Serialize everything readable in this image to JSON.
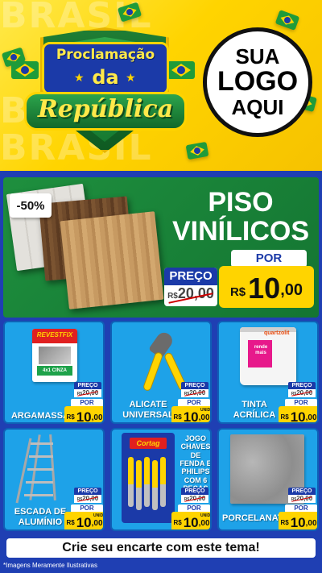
{
  "header": {
    "bg_words": [
      "BRASIL",
      "BRASIL",
      "BRASIL"
    ],
    "title_line1": "Proclamação",
    "title_line2": "da",
    "title_line3": "República",
    "logo_lines": [
      "SUA",
      "LOGO",
      "AQUI"
    ]
  },
  "featured": {
    "discount": "-50%",
    "name_line1": "PISO",
    "name_line2": "VINÍLICOS",
    "por_label": "POR",
    "preco_label": "PREÇO",
    "old_currency": "R$",
    "old_value": "20,00",
    "new_currency": "R$",
    "new_int": "10",
    "new_dec": ",00"
  },
  "products": [
    {
      "name": "ARGAMASSA",
      "brand": "REVESTFIX",
      "label": "4x1 CINZA",
      "preco_label": "PREÇO",
      "old_currency": "R$",
      "old_value": "20,00",
      "por_label": "POR",
      "currency": "R$",
      "int": "10",
      "dec": ",00",
      "unit": ""
    },
    {
      "name": "ALICATE UNIVERSAL",
      "preco_label": "PREÇO",
      "old_currency": "R$",
      "old_value": "20,00",
      "por_label": "POR",
      "currency": "R$",
      "int": "10",
      "dec": ",00",
      "unit": "UNID"
    },
    {
      "name": "TINTA ACRÍLICA",
      "brand": "quartzolit",
      "label": "rende mais",
      "preco_label": "PREÇO",
      "old_currency": "R$",
      "old_value": "20,00",
      "por_label": "POR",
      "currency": "R$",
      "int": "10",
      "dec": ",00",
      "unit": ""
    },
    {
      "name": "ESCADA DE ALUMÍNIO",
      "preco_label": "PREÇO",
      "old_currency": "R$",
      "old_value": "20,00",
      "por_label": "POR",
      "currency": "R$",
      "int": "10",
      "dec": ",00",
      "unit": "UNID"
    },
    {
      "name": "JOGO CHAVES DE FENDA E PHILIPS COM 6 PEÇAS",
      "brand": "Cortag",
      "preco_label": "PREÇO",
      "old_currency": "R$",
      "old_value": "20,00",
      "por_label": "POR",
      "currency": "R$",
      "int": "10",
      "dec": ",00",
      "unit": "UNID"
    },
    {
      "name": "PORCELANATO",
      "preco_label": "PREÇO",
      "old_currency": "R$",
      "old_value": "20,00",
      "por_label": "POR",
      "currency": "R$",
      "int": "10",
      "dec": ",00",
      "unit": ""
    }
  ],
  "footer": {
    "cta": "Crie seu encarte com este tema!",
    "disclaimer": "*Imagens Meramente Ilustrativas"
  },
  "colors": {
    "background_blue": "#1f3fb3",
    "header_yellow": "#ffd400",
    "featured_green": "#1e8f3e",
    "card_blue": "#1ea2e8",
    "price_yellow": "#ffd400",
    "tag_blue": "#1b3aa8"
  }
}
